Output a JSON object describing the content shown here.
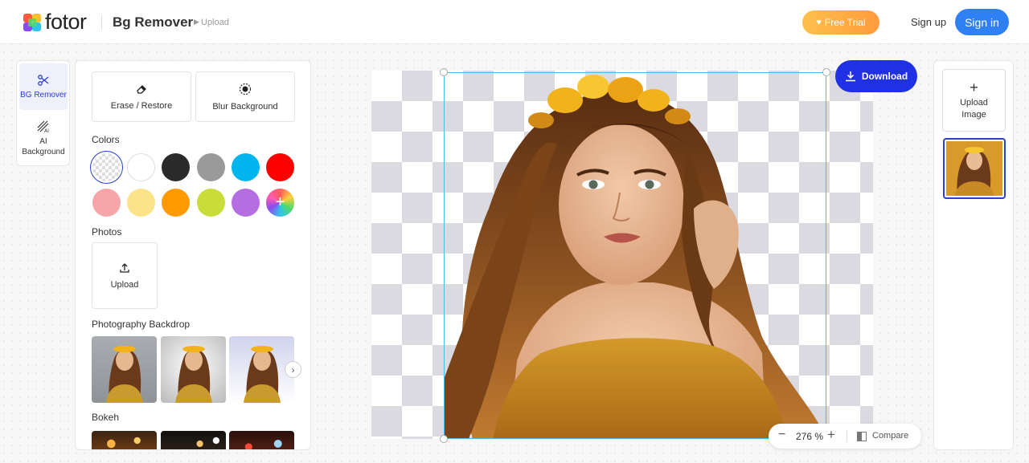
{
  "header": {
    "brand": "fotor",
    "app_title": "Bg Remover",
    "breadcrumb": "Upload",
    "free_trial_label": "Free Trial",
    "sign_up_label": "Sign up",
    "sign_in_label": "Sign in"
  },
  "rail": {
    "items": [
      {
        "label": "BG Remover",
        "icon": "scissors-icon",
        "active": true
      },
      {
        "label": "AI Background",
        "icon": "ai-pattern-icon",
        "active": false
      }
    ]
  },
  "panel": {
    "tools": [
      {
        "label": "Erase / Restore",
        "icon": "eraser-icon"
      },
      {
        "label": "Blur Background",
        "icon": "blur-icon"
      }
    ],
    "colors_label": "Colors",
    "colors": [
      "transparent",
      "#ffffff",
      "#2a2a2a",
      "#999a99",
      "#00b4ee",
      "#ff0000",
      "#f6a6a9",
      "#fce38a",
      "#ff9a00",
      "#c8dc3a",
      "#b56ee0",
      "custom"
    ],
    "photos_label": "Photos",
    "upload_label": "Upload",
    "backdrop_label": "Photography Backdrop",
    "bokeh_label": "Bokeh"
  },
  "canvas": {
    "download_label": "Download",
    "zoom": "276 %",
    "compare_label": "Compare"
  },
  "right_panel": {
    "upload_image_label_line1": "Upload",
    "upload_image_label_line2": "Image"
  }
}
